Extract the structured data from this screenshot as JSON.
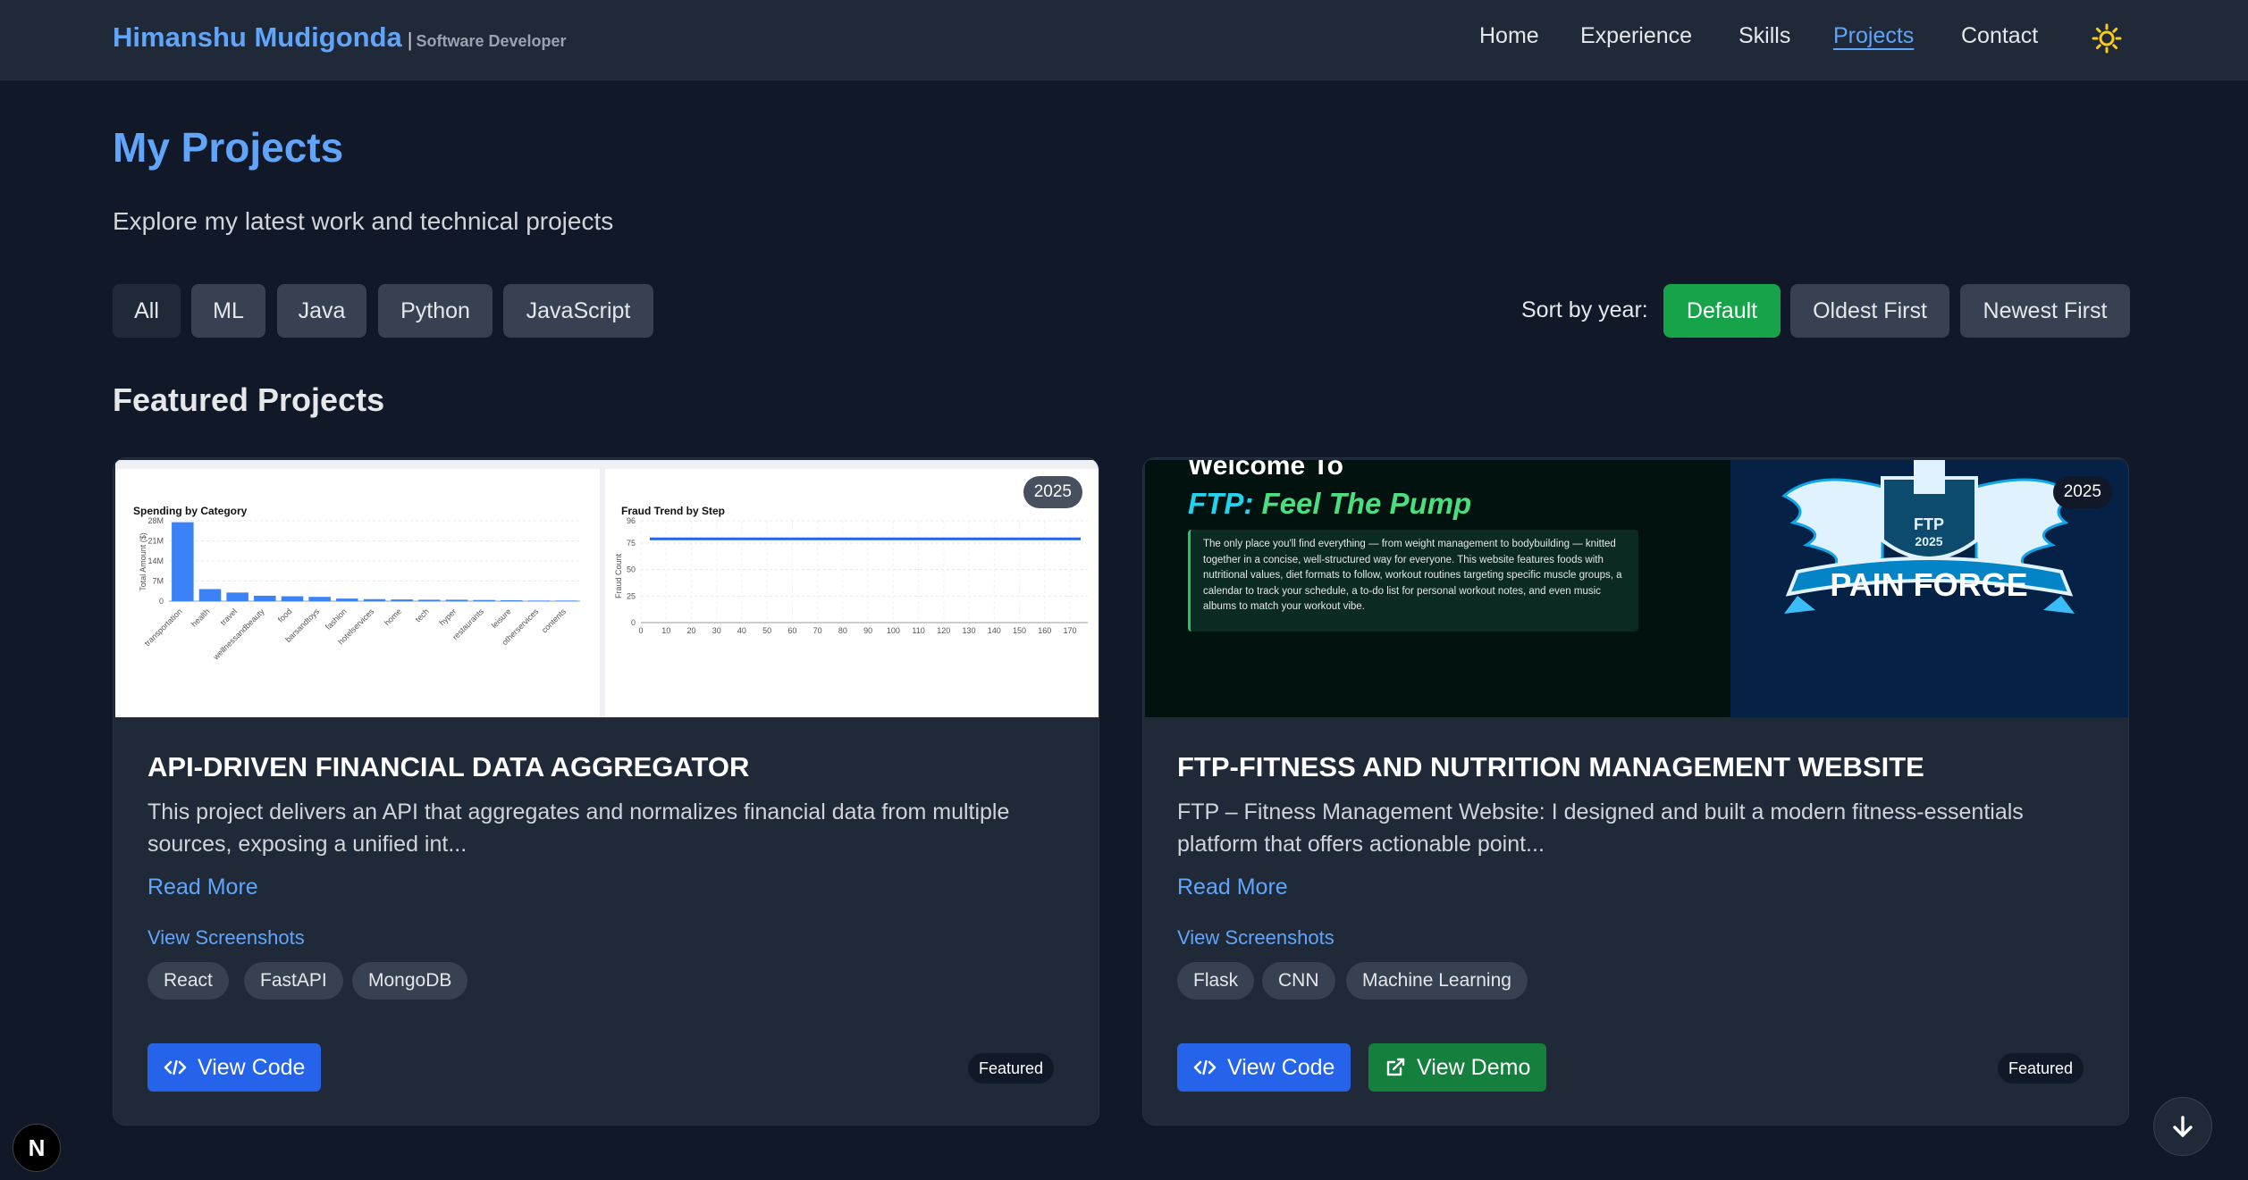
{
  "nav": {
    "brand_name": "Himanshu Mudigonda",
    "brand_sep": "|",
    "brand_role": "Software Developer",
    "links": [
      "Home",
      "Experience",
      "Skills",
      "Projects",
      "Contact"
    ],
    "active_link": "Projects",
    "theme_icon": "sun-icon",
    "accent_color": "#60a5fa"
  },
  "hero": {
    "title": "My Projects",
    "subtitle": "Explore my latest work and technical projects"
  },
  "filters": {
    "items": [
      "All",
      "ML",
      "Java",
      "Python",
      "JavaScript"
    ],
    "active": "All"
  },
  "sort": {
    "label": "Sort by year:",
    "options": [
      "Default",
      "Oldest First",
      "Newest First"
    ],
    "active": "Default",
    "active_color": "#16a34a"
  },
  "featured_section": {
    "title": "Featured Projects"
  },
  "projects": [
    {
      "title": "API-DRIVEN FINANCIAL DATA AGGREGATOR",
      "year": "2025",
      "description": "This project delivers an API that aggregates and normalizes financial data from multiple sources, exposing a unified int...",
      "read_more": "Read More",
      "screenshots_link": "View Screenshots",
      "tags": [
        "React",
        "FastAPI",
        "MongoDB"
      ],
      "code_label": "View Code",
      "badge": "Featured",
      "screenshot": {
        "left_title": "Spending by Category",
        "left_ylabel": "Total Amount ($)",
        "left_yticks": [
          "28M",
          "21M",
          "14M",
          "7M",
          "0"
        ],
        "left_categories": [
          "transportation",
          "health",
          "travel",
          "wellnessandbeauty",
          "food",
          "barsandtoys",
          "fashion",
          "hotelservices",
          "home",
          "tech",
          "hyper",
          "restaurants",
          "leisure",
          "otherservices",
          "contents"
        ],
        "left_values": [
          27.5,
          4.2,
          3.0,
          1.9,
          1.7,
          1.5,
          0.9,
          0.7,
          0.6,
          0.5,
          0.5,
          0.4,
          0.3,
          0.2,
          0.2
        ],
        "right_title": "Fraud Trend by Step",
        "right_ylabel": "Fraud Count",
        "right_yticks": [
          "96",
          "75",
          "50",
          "25",
          "0"
        ],
        "right_xticks": [
          "0",
          "10",
          "20",
          "30",
          "40",
          "50",
          "60",
          "70",
          "80",
          "90",
          "100",
          "110",
          "120",
          "130",
          "140",
          "150",
          "160",
          "170"
        ],
        "right_line_value": 79
      }
    },
    {
      "title": "FTP-FITNESS AND NUTRITION MANAGEMENT WEBSITE",
      "year": "2025",
      "description": "FTP – Fitness Management Website: I designed and built a modern fitness-essentials platform that offers actionable point...",
      "read_more": "Read More",
      "screenshots_link": "View Screenshots",
      "tags": [
        "Flask",
        "CNN",
        "Machine Learning"
      ],
      "code_label": "View Code",
      "demo_label": "View Demo",
      "badge": "Featured",
      "screenshot": {
        "welcome": "Welcome To",
        "headline_prefix": "FTP:",
        "headline": "Feel The Pump",
        "blurb": "The only place you'll find everything — from weight management to bodybuilding — knitted together in a concise, well-structured way for everyone. This website features foods with nutritional values, diet formats to follow, workout routines targeting specific muscle groups, a calendar to track your schedule, a to-do list for personal workout notes, and even music albums to match your workout vibe.",
        "logo_top": "FTP",
        "logo_year": "2025",
        "logo_text": "PAIN FORGE"
      }
    }
  ],
  "floating": {
    "scroll_icon": "arrow-down-icon",
    "dev_badge": "N"
  }
}
